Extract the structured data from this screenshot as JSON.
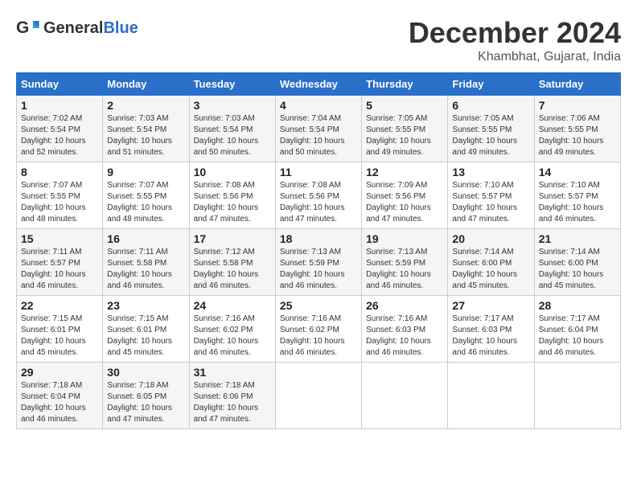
{
  "header": {
    "logo_general": "General",
    "logo_blue": "Blue",
    "month_title": "December 2024",
    "location": "Khambhat, Gujarat, India"
  },
  "weekdays": [
    "Sunday",
    "Monday",
    "Tuesday",
    "Wednesday",
    "Thursday",
    "Friday",
    "Saturday"
  ],
  "weeks": [
    [
      {
        "day": "1",
        "sunrise": "Sunrise: 7:02 AM",
        "sunset": "Sunset: 5:54 PM",
        "daylight": "Daylight: 10 hours and 52 minutes."
      },
      {
        "day": "2",
        "sunrise": "Sunrise: 7:03 AM",
        "sunset": "Sunset: 5:54 PM",
        "daylight": "Daylight: 10 hours and 51 minutes."
      },
      {
        "day": "3",
        "sunrise": "Sunrise: 7:03 AM",
        "sunset": "Sunset: 5:54 PM",
        "daylight": "Daylight: 10 hours and 50 minutes."
      },
      {
        "day": "4",
        "sunrise": "Sunrise: 7:04 AM",
        "sunset": "Sunset: 5:54 PM",
        "daylight": "Daylight: 10 hours and 50 minutes."
      },
      {
        "day": "5",
        "sunrise": "Sunrise: 7:05 AM",
        "sunset": "Sunset: 5:55 PM",
        "daylight": "Daylight: 10 hours and 49 minutes."
      },
      {
        "day": "6",
        "sunrise": "Sunrise: 7:05 AM",
        "sunset": "Sunset: 5:55 PM",
        "daylight": "Daylight: 10 hours and 49 minutes."
      },
      {
        "day": "7",
        "sunrise": "Sunrise: 7:06 AM",
        "sunset": "Sunset: 5:55 PM",
        "daylight": "Daylight: 10 hours and 49 minutes."
      }
    ],
    [
      {
        "day": "8",
        "sunrise": "Sunrise: 7:07 AM",
        "sunset": "Sunset: 5:55 PM",
        "daylight": "Daylight: 10 hours and 48 minutes."
      },
      {
        "day": "9",
        "sunrise": "Sunrise: 7:07 AM",
        "sunset": "Sunset: 5:55 PM",
        "daylight": "Daylight: 10 hours and 48 minutes."
      },
      {
        "day": "10",
        "sunrise": "Sunrise: 7:08 AM",
        "sunset": "Sunset: 5:56 PM",
        "daylight": "Daylight: 10 hours and 47 minutes."
      },
      {
        "day": "11",
        "sunrise": "Sunrise: 7:08 AM",
        "sunset": "Sunset: 5:56 PM",
        "daylight": "Daylight: 10 hours and 47 minutes."
      },
      {
        "day": "12",
        "sunrise": "Sunrise: 7:09 AM",
        "sunset": "Sunset: 5:56 PM",
        "daylight": "Daylight: 10 hours and 47 minutes."
      },
      {
        "day": "13",
        "sunrise": "Sunrise: 7:10 AM",
        "sunset": "Sunset: 5:57 PM",
        "daylight": "Daylight: 10 hours and 47 minutes."
      },
      {
        "day": "14",
        "sunrise": "Sunrise: 7:10 AM",
        "sunset": "Sunset: 5:57 PM",
        "daylight": "Daylight: 10 hours and 46 minutes."
      }
    ],
    [
      {
        "day": "15",
        "sunrise": "Sunrise: 7:11 AM",
        "sunset": "Sunset: 5:57 PM",
        "daylight": "Daylight: 10 hours and 46 minutes."
      },
      {
        "day": "16",
        "sunrise": "Sunrise: 7:11 AM",
        "sunset": "Sunset: 5:58 PM",
        "daylight": "Daylight: 10 hours and 46 minutes."
      },
      {
        "day": "17",
        "sunrise": "Sunrise: 7:12 AM",
        "sunset": "Sunset: 5:58 PM",
        "daylight": "Daylight: 10 hours and 46 minutes."
      },
      {
        "day": "18",
        "sunrise": "Sunrise: 7:13 AM",
        "sunset": "Sunset: 5:59 PM",
        "daylight": "Daylight: 10 hours and 46 minutes."
      },
      {
        "day": "19",
        "sunrise": "Sunrise: 7:13 AM",
        "sunset": "Sunset: 5:59 PM",
        "daylight": "Daylight: 10 hours and 46 minutes."
      },
      {
        "day": "20",
        "sunrise": "Sunrise: 7:14 AM",
        "sunset": "Sunset: 6:00 PM",
        "daylight": "Daylight: 10 hours and 45 minutes."
      },
      {
        "day": "21",
        "sunrise": "Sunrise: 7:14 AM",
        "sunset": "Sunset: 6:00 PM",
        "daylight": "Daylight: 10 hours and 45 minutes."
      }
    ],
    [
      {
        "day": "22",
        "sunrise": "Sunrise: 7:15 AM",
        "sunset": "Sunset: 6:01 PM",
        "daylight": "Daylight: 10 hours and 45 minutes."
      },
      {
        "day": "23",
        "sunrise": "Sunrise: 7:15 AM",
        "sunset": "Sunset: 6:01 PM",
        "daylight": "Daylight: 10 hours and 45 minutes."
      },
      {
        "day": "24",
        "sunrise": "Sunrise: 7:16 AM",
        "sunset": "Sunset: 6:02 PM",
        "daylight": "Daylight: 10 hours and 46 minutes."
      },
      {
        "day": "25",
        "sunrise": "Sunrise: 7:16 AM",
        "sunset": "Sunset: 6:02 PM",
        "daylight": "Daylight: 10 hours and 46 minutes."
      },
      {
        "day": "26",
        "sunrise": "Sunrise: 7:16 AM",
        "sunset": "Sunset: 6:03 PM",
        "daylight": "Daylight: 10 hours and 46 minutes."
      },
      {
        "day": "27",
        "sunrise": "Sunrise: 7:17 AM",
        "sunset": "Sunset: 6:03 PM",
        "daylight": "Daylight: 10 hours and 46 minutes."
      },
      {
        "day": "28",
        "sunrise": "Sunrise: 7:17 AM",
        "sunset": "Sunset: 6:04 PM",
        "daylight": "Daylight: 10 hours and 46 minutes."
      }
    ],
    [
      {
        "day": "29",
        "sunrise": "Sunrise: 7:18 AM",
        "sunset": "Sunset: 6:04 PM",
        "daylight": "Daylight: 10 hours and 46 minutes."
      },
      {
        "day": "30",
        "sunrise": "Sunrise: 7:18 AM",
        "sunset": "Sunset: 6:05 PM",
        "daylight": "Daylight: 10 hours and 47 minutes."
      },
      {
        "day": "31",
        "sunrise": "Sunrise: 7:18 AM",
        "sunset": "Sunset: 6:06 PM",
        "daylight": "Daylight: 10 hours and 47 minutes."
      },
      null,
      null,
      null,
      null
    ]
  ]
}
